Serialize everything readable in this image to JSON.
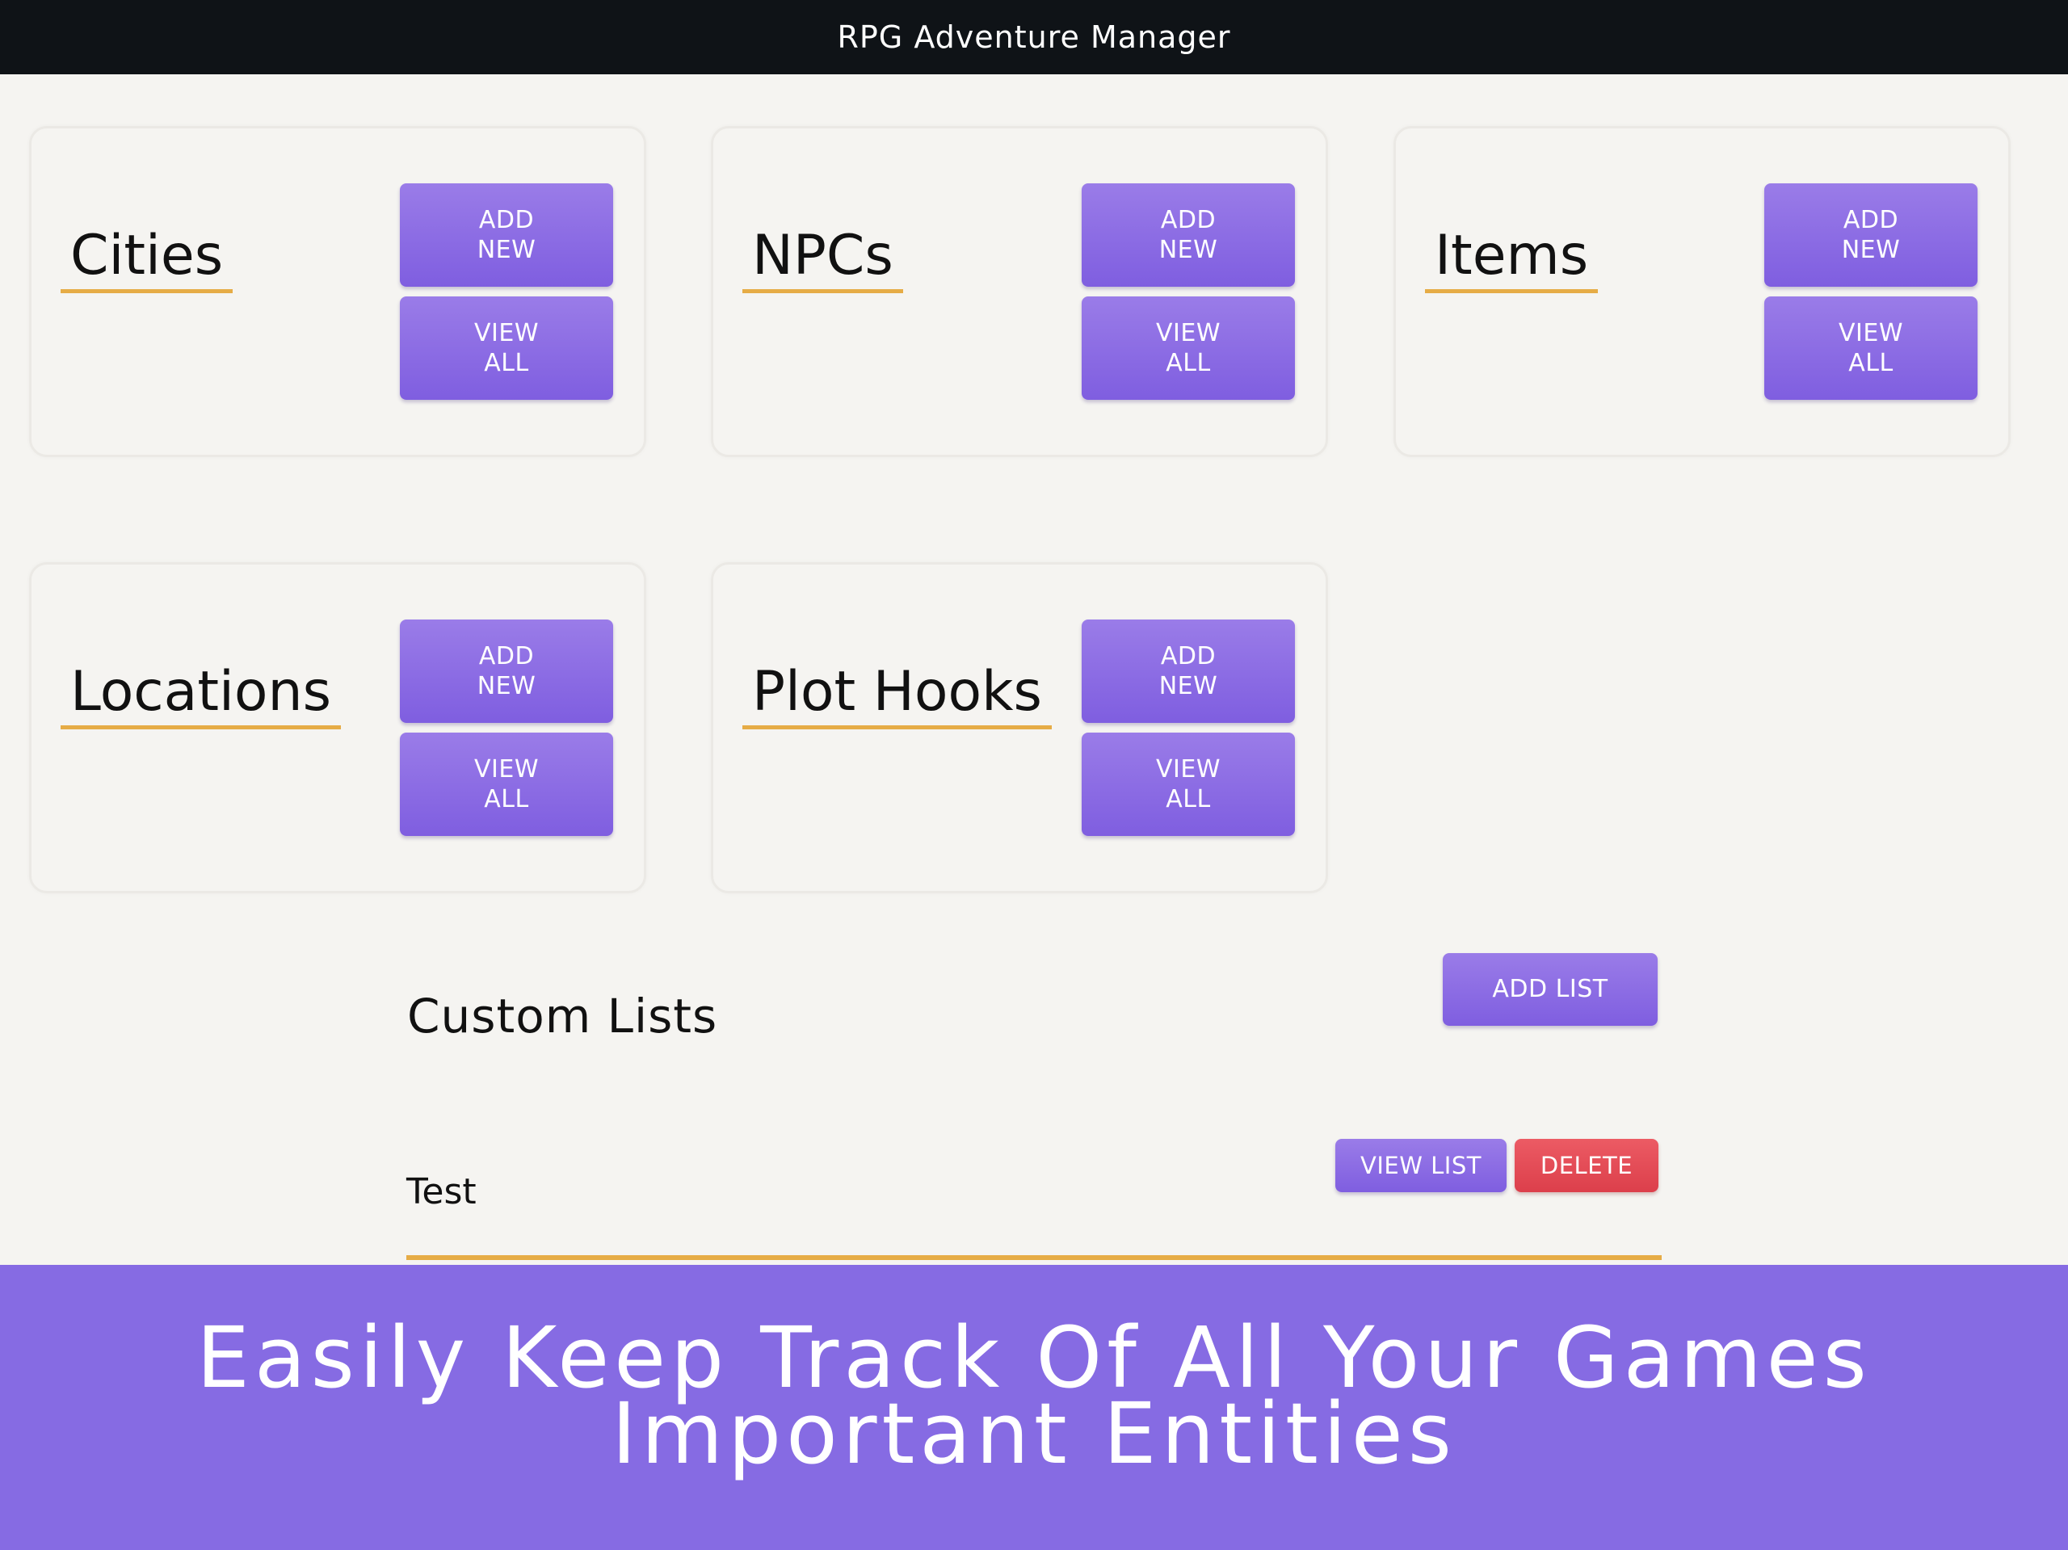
{
  "header": {
    "title": "RPG Adventure Manager"
  },
  "colors": {
    "accent": "#866be3",
    "button": "#8a6ce3",
    "underline": "#e6ac46",
    "danger": "#dc3f4b",
    "topbar": "#0f1317"
  },
  "cards": [
    {
      "title": "Cities",
      "add_label": "ADD\nNEW",
      "view_label": "VIEW\nALL"
    },
    {
      "title": "NPCs",
      "add_label": "ADD\nNEW",
      "view_label": "VIEW\nALL"
    },
    {
      "title": "Items",
      "add_label": "ADD\nNEW",
      "view_label": "VIEW\nALL"
    },
    {
      "title": "Locations",
      "add_label": "ADD\nNEW",
      "view_label": "VIEW\nALL"
    },
    {
      "title": "Plot Hooks",
      "add_label": "ADD\nNEW",
      "view_label": "VIEW\nALL"
    }
  ],
  "custom_lists": {
    "title": "Custom Lists",
    "add_label": "ADD LIST",
    "items": [
      {
        "name": "Test",
        "view_label": "VIEW LIST",
        "delete_label": "DELETE"
      }
    ]
  },
  "banner": {
    "line1": "Easily Keep Track Of All Your Games",
    "line2": "Important Entities"
  }
}
